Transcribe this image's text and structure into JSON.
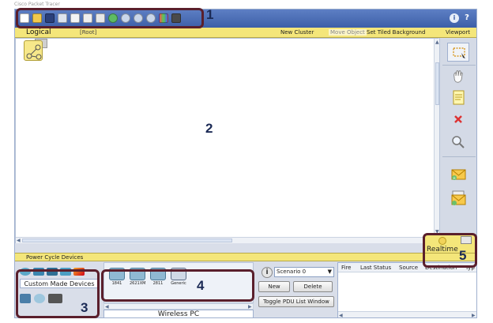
{
  "titlebar": {
    "text": "Cisco Packet Tracer"
  },
  "toolbar": {
    "icons": [
      "new-file-icon",
      "open-folder-icon",
      "save-icon",
      "print-icon",
      "activity-wizard-icon",
      "copy-icon",
      "paste-icon",
      "undo-icon",
      "zoom-in-icon",
      "zoom-reset-icon",
      "zoom-out-icon",
      "palette-icon",
      "custom-device-dialog-icon"
    ],
    "info_label": "i",
    "help_label": "?"
  },
  "logicalbar": {
    "logical": "Logical",
    "root": "[Root]",
    "new_cluster": "New Cluster",
    "move_object": "Move Object",
    "tiled_background": "Set Tiled Background",
    "viewport": "Viewport"
  },
  "annotations": {
    "one": "1",
    "two": "2",
    "three": "3",
    "four": "4",
    "five": "5"
  },
  "bottombar": {
    "power_cycle": "Power Cycle Devices"
  },
  "realtime": {
    "label": "Realtime"
  },
  "device_types": {
    "custom_label": "Custom Made Devices"
  },
  "devices": {
    "items": [
      {
        "label": "1841"
      },
      {
        "label": "2621XM"
      },
      {
        "label": "2811"
      },
      {
        "label": "Generic"
      }
    ],
    "selected_label": "Wireless PC"
  },
  "scenario": {
    "info": "i",
    "selected": "Scenario 0",
    "new_label": "New",
    "delete_label": "Delete",
    "toggle_label": "Toggle PDU List Window"
  },
  "pdu_table": {
    "columns": [
      "Fire",
      "Last Status",
      "Source",
      "Destination",
      "Typ"
    ]
  },
  "colors": {
    "toolbar": "#3d5fa8",
    "yellow_bar": "#f4e67a",
    "annotation_box": "#5a1f2c",
    "annotation_number": "#1b2a55"
  }
}
